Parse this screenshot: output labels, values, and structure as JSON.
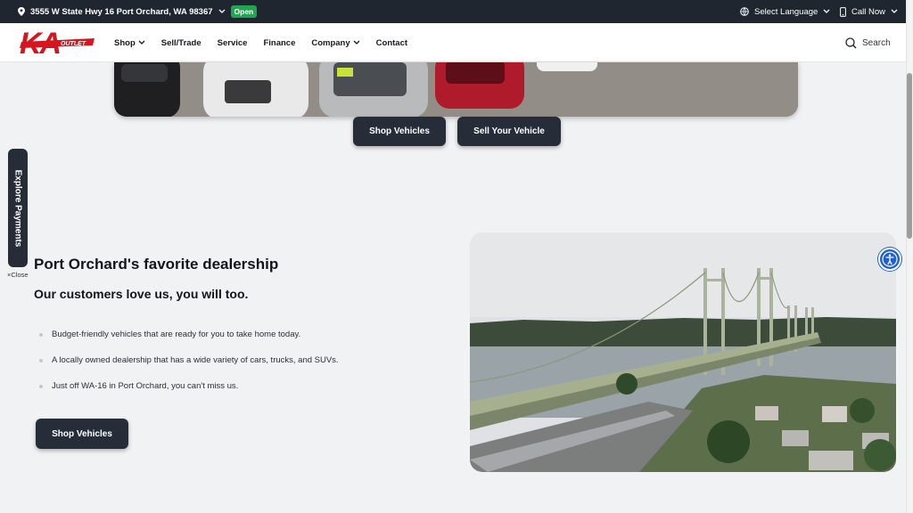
{
  "topbar": {
    "address": "3555 W State Hwy 16 Port Orchard, WA 98367",
    "status": "Open",
    "language_label": "Select Language",
    "call_label": "Call Now"
  },
  "nav": {
    "logo_text": "KA",
    "logo_sub": "OUTLET",
    "items": [
      {
        "label": "Shop",
        "dropdown": true
      },
      {
        "label": "Sell/Trade",
        "dropdown": false
      },
      {
        "label": "Service",
        "dropdown": false
      },
      {
        "label": "Finance",
        "dropdown": false
      },
      {
        "label": "Company",
        "dropdown": true
      },
      {
        "label": "Contact",
        "dropdown": false
      }
    ],
    "search_label": "Search"
  },
  "hero": {
    "shop_button": "Shop Vehicles",
    "sell_button": "Sell Your Vehicle"
  },
  "side_tab": {
    "label": "Explore Payments",
    "close_label": "Close"
  },
  "section": {
    "heading": "Port Orchard's favorite dealership",
    "subheading": "Our customers love us, you will too.",
    "bullets": [
      "Budget-friendly vehicles that are ready for you to take home today.",
      "A locally owned dealership that has a wide variety of cars, trucks, and SUVs.",
      "Just off WA-16 in Port Orchard, you can't miss us."
    ],
    "button": "Shop Vehicles"
  },
  "colors": {
    "topbar_bg": "#1f2630",
    "button_bg": "#262d38",
    "brand_red": "#d4171f",
    "open_green": "#23a455",
    "a11y_blue": "#1c5fd6"
  },
  "icons": {
    "location": "map-pin-icon",
    "language": "globe-icon",
    "phone": "phone-icon",
    "search": "search-icon",
    "accessibility": "accessibility-icon"
  }
}
